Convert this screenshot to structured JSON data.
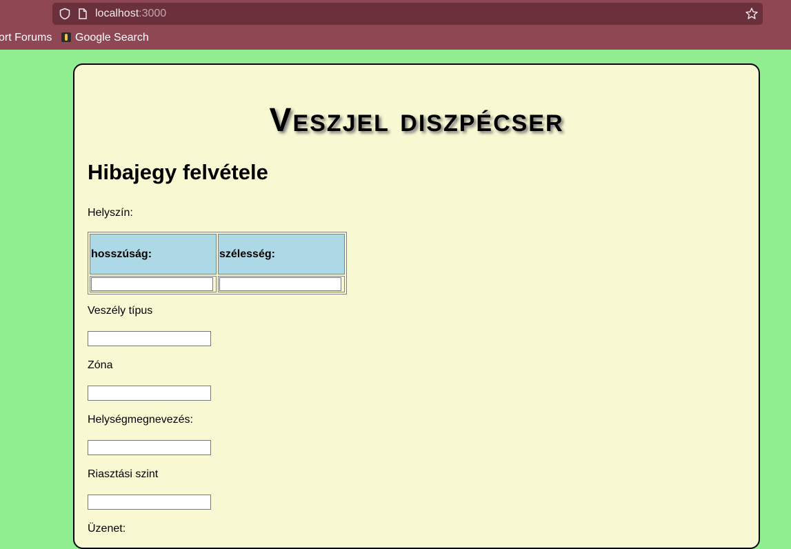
{
  "browser": {
    "url_host": "localhost",
    "url_port": ":3000",
    "bookmarks": [
      {
        "label": "ort Forums"
      },
      {
        "label": "Google Search"
      }
    ]
  },
  "page": {
    "app_title": "Veszjel diszpécser",
    "heading": "Hibajegy felvétele",
    "location_label": "Helyszín:",
    "table": {
      "headers": [
        "hosszúság:",
        "szélesség:"
      ],
      "values": [
        "",
        ""
      ]
    },
    "fields": [
      {
        "label": "Veszély típus",
        "value": ""
      },
      {
        "label": "Zóna",
        "value": ""
      },
      {
        "label": "Helységmegnevezés:",
        "value": ""
      },
      {
        "label": "Riasztási szint",
        "value": ""
      },
      {
        "label": "Üzenet:",
        "value": ""
      }
    ]
  },
  "colors": {
    "page_bg": "#90ee90",
    "card_bg": "#f8f8d2",
    "header_cell_bg": "#add8e6",
    "chrome_bg": "#8e4753"
  }
}
